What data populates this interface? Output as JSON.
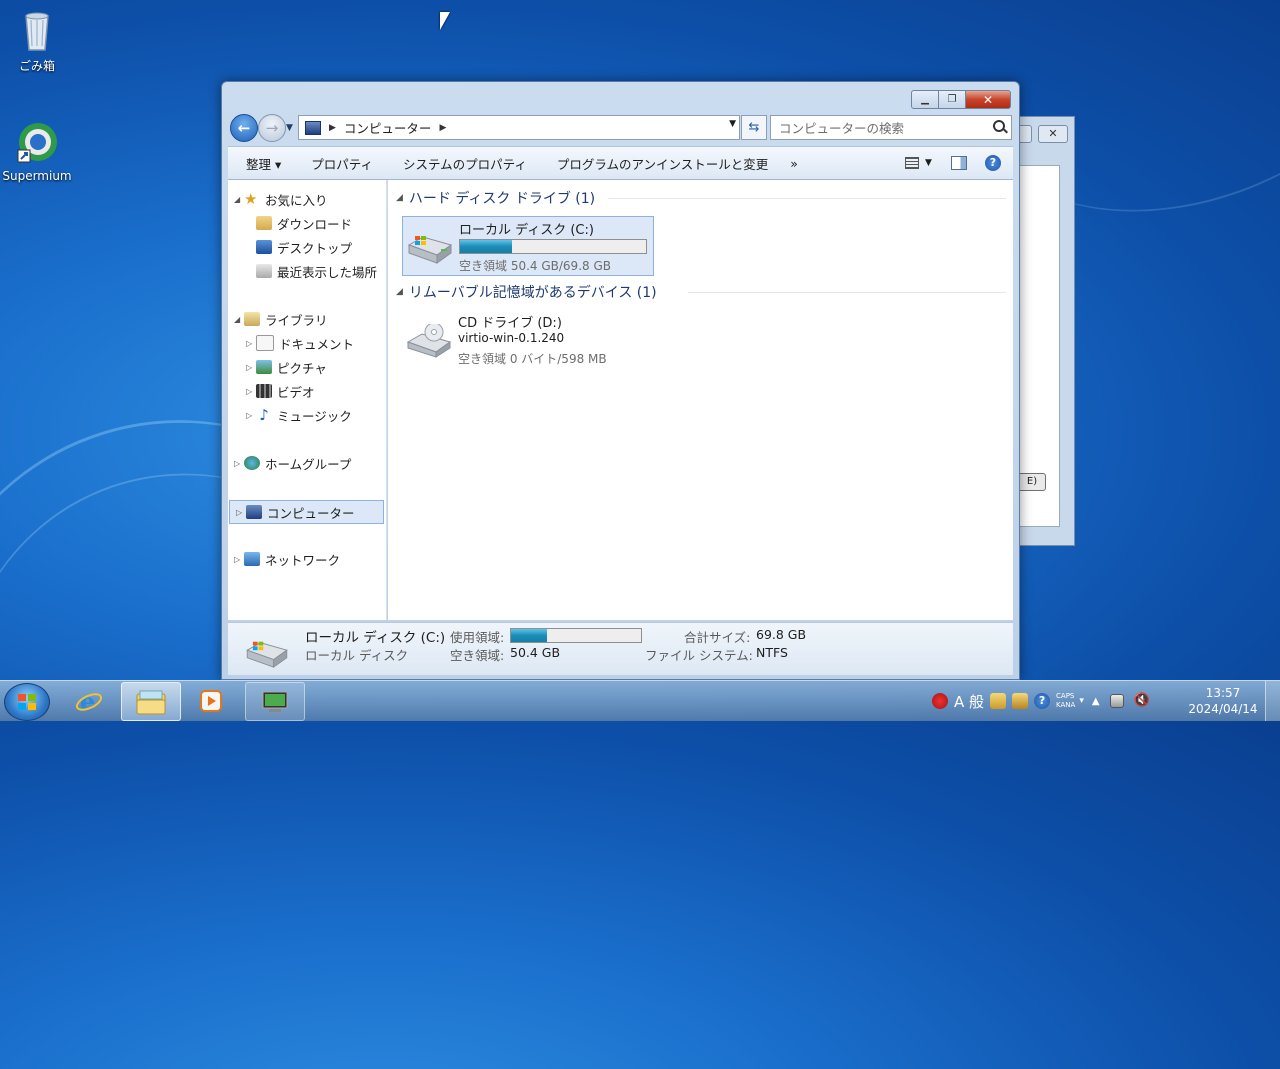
{
  "desktop": {
    "icons": [
      {
        "label": "ごみ箱",
        "icon": "recycle-bin-icon"
      },
      {
        "label": "Supermium",
        "icon": "supermium-browser-icon"
      }
    ]
  },
  "explorer": {
    "address": {
      "segment": "コンピューター"
    },
    "search": {
      "placeholder": "コンピューターの検索"
    },
    "toolbar": {
      "organize": "整理 ▾",
      "properties": "プロパティ",
      "system_properties": "システムのプロパティ",
      "uninstall": "プログラムのアンインストールと変更",
      "more": "»"
    },
    "sidebar": {
      "favorites": "お気に入り",
      "downloads": "ダウンロード",
      "desktop": "デスクトップ",
      "recent": "最近表示した場所",
      "libraries": "ライブラリ",
      "documents": "ドキュメント",
      "pictures": "ピクチャ",
      "videos": "ビデオ",
      "music": "ミュージック",
      "homegroup": "ホームグループ",
      "computer": "コンピューター",
      "network": "ネットワーク"
    },
    "groups": {
      "hdd": "ハード ディスク ドライブ (1)",
      "removable": "リムーバブル記憶域があるデバイス (1)"
    },
    "drives": {
      "c": {
        "name": "ローカル ディスク (C:)",
        "free": "空き領域 50.4 GB/69.8 GB",
        "used_fraction": 0.28
      },
      "d": {
        "name": "CD ドライブ (D:)",
        "label": "virtio-win-0.1.240",
        "free": "空き領域 0 バイト/598 MB"
      }
    },
    "details": {
      "name": "ローカル ディスク (C:)",
      "type": "ローカル ディスク",
      "used_label": "使用領域:",
      "free_label": "空き領域:",
      "free_value": "50.4 GB",
      "total_label": "合計サイズ:",
      "total_value": "69.8 GB",
      "fs_label": "ファイル システム:",
      "fs_value": "NTFS",
      "used_fraction": 0.28
    }
  },
  "back_window": {
    "button": "E)"
  },
  "taskbar": {
    "clock_time": "13:57",
    "clock_date": "2024/04/14",
    "ime_mode": "A 般",
    "caps": "CAPS",
    "kana": "KANA"
  }
}
